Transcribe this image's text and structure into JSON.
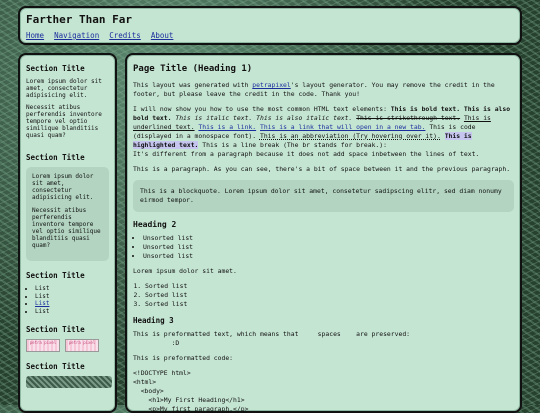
{
  "header": {
    "title": "Farther Than Far",
    "nav": [
      "Home",
      "Navigation",
      "Credits",
      "About"
    ]
  },
  "sidebar": {
    "section1": {
      "title": "Section Title",
      "paragraphs": [
        "Lorem ipsum dolor sit amet, consectetur adipisicing elit.",
        "Necessit atibus perferendis inventore tempore vel optio similique blanditiis quasi quam?"
      ]
    },
    "section2": {
      "title": "Section Title",
      "paragraphs": [
        "Lorem ipsum dolor sit amet, consectetur adipisicing elit.",
        "Necessit atibus perferendis inventore tempore vel optio similique blanditiis quasi quam?"
      ]
    },
    "section3": {
      "title": "Section Title",
      "items": [
        "List",
        "List",
        "List",
        "List"
      ]
    },
    "section4": {
      "title": "Section Title",
      "stamps": [
        "petra pixel",
        "petra pixel"
      ]
    },
    "section5": {
      "title": "Section Title"
    }
  },
  "main": {
    "title": "Page Title (Heading 1)",
    "credit": {
      "before": "This layout was generated with ",
      "link": "petrapixel",
      "after": "'s layout generator. You may remove the credit in the footer, but please leave the credit in the code. Thank you!"
    },
    "elements": {
      "intro": "I will now show you how to use the most common HTML text elements: ",
      "bold1": "This is bold text.",
      "bold2": "This is also bold text.",
      "italic1": "This is italic text.",
      "italic2": "This is also italic text.",
      "strike": "This is strikethrough text.",
      "underline": "This is underlined text.",
      "link": "This is a link.",
      "link_new_tab": "This is a link that will open in a new tab.",
      "code": "This is code (displayed in a monospace font).",
      "abbr": "This is an abbreviation (Try hovering over it).",
      "highlight": "This is highlighted text.",
      "linebreak": "This is a line break (The br stands for break.):",
      "different": "It's different from a paragraph because it does not add space inbetween the lines of text."
    },
    "para2": "This is a paragraph. As you can see, there's a bit of space between it and the previous paragraph.",
    "blockquote": "This is a blockquote. Lorem ipsum dolor sit amet, consetetur sadipscing elitr, sed diam nonumy eirmod tempor.",
    "h2": "Heading 2",
    "unsorted": [
      "Unsorted list",
      "Unsorted list",
      "Unsorted list"
    ],
    "lorem": "Lorem ipsum dolor sit amet.",
    "sorted": [
      "Sorted list",
      "Sorted list",
      "Sorted list"
    ],
    "h3": "Heading 3",
    "pre1": "This is preformatted text, which means that     spaces    are preserved:\n          :D",
    "pre_code_label": "This is preformatted code:",
    "code_lines": [
      "<!DOCTYPE html>",
      "<html>",
      "  <body>",
      "    <h1>My First Heading</h1>",
      "    <p>My first paragraph.</p>"
    ]
  }
}
